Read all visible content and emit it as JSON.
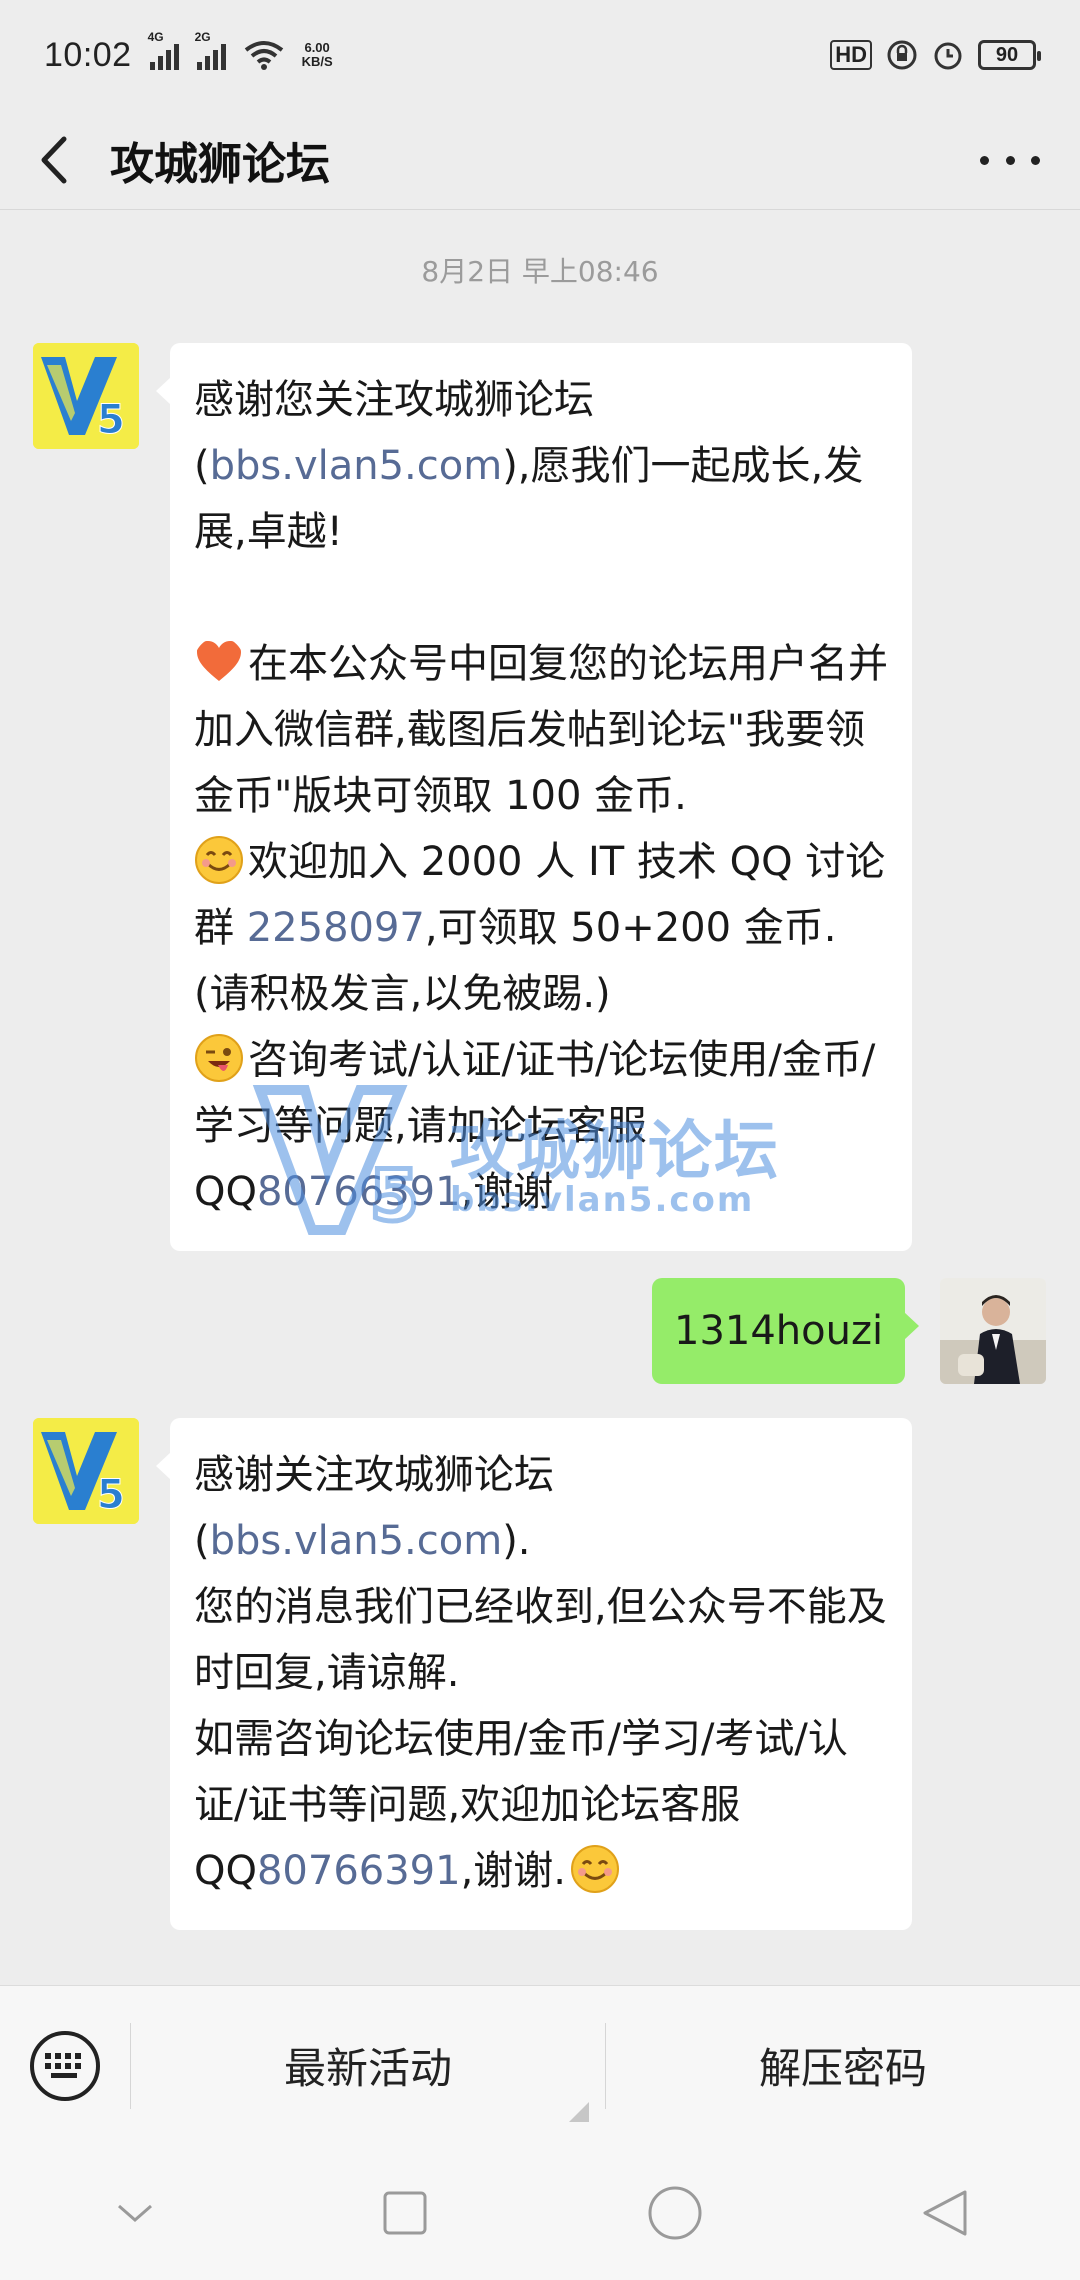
{
  "status_bar": {
    "time": "10:02",
    "signal1_label": "4G",
    "signal2_label": "2G",
    "net_speed": "6.00",
    "net_unit": "KB/S",
    "hd_label": "HD",
    "battery": "90"
  },
  "nav": {
    "title": "攻城狮论坛"
  },
  "chat": {
    "timestamp": "8月2日 早上08:46",
    "msg1": {
      "p1_a": "感谢您关注攻城狮论坛(",
      "p1_link": "bbs.vlan5.com",
      "p1_b": "),愿我们一起成长,发展,卓越!",
      "p2": "在本公众号中回复您的论坛用户名并加入微信群,截图后发帖到论坛\"我要领金币\"版块可领取 100 金币.",
      "p3_a": "欢迎加入 2000 人 IT 技术 QQ 讨论群 ",
      "p3_link": "2258097",
      "p3_b": ",可领取 50+200 金币.(请积极发言,以免被踢.)",
      "p4_a": "咨询考试/认证/证书/论坛使用/金币/学习等问题,请加论坛客服QQ",
      "p4_link": "80766391",
      "p4_b": ",谢谢"
    },
    "msg_user": "1314houzi",
    "msg3": {
      "p1_a": "感谢关注攻城狮论坛(",
      "p1_link": "bbs.vlan5.com",
      "p1_b": ").",
      "p2": "您的消息我们已经收到,但公众号不能及时回复,请谅解.",
      "p3_a": "如需咨询论坛使用/金币/学习/考试/认证/证书等问题,欢迎加论坛客服QQ",
      "p3_link": "80766391",
      "p3_b": ",谢谢."
    },
    "watermark_cn": "攻城狮论坛",
    "watermark_url": "bbs.vlan5.com",
    "logo_text": "V5",
    "link_color": "#576b95",
    "user_bubble_color": "#95ec69"
  },
  "bottom_menu": {
    "item1": "最新活动",
    "item2": "解压密码"
  },
  "icons": {
    "back": "chevron-left-icon",
    "more": "more-dots-icon",
    "keyboard": "keyboard-icon",
    "heart": "heart-emoji-icon",
    "smile": "smile-emoji-icon",
    "wink": "wink-emoji-icon",
    "sys_back": "triangle-back-icon",
    "sys_home": "circle-home-icon",
    "sys_recent": "square-recents-icon",
    "sys_down": "chevron-down-icon"
  }
}
